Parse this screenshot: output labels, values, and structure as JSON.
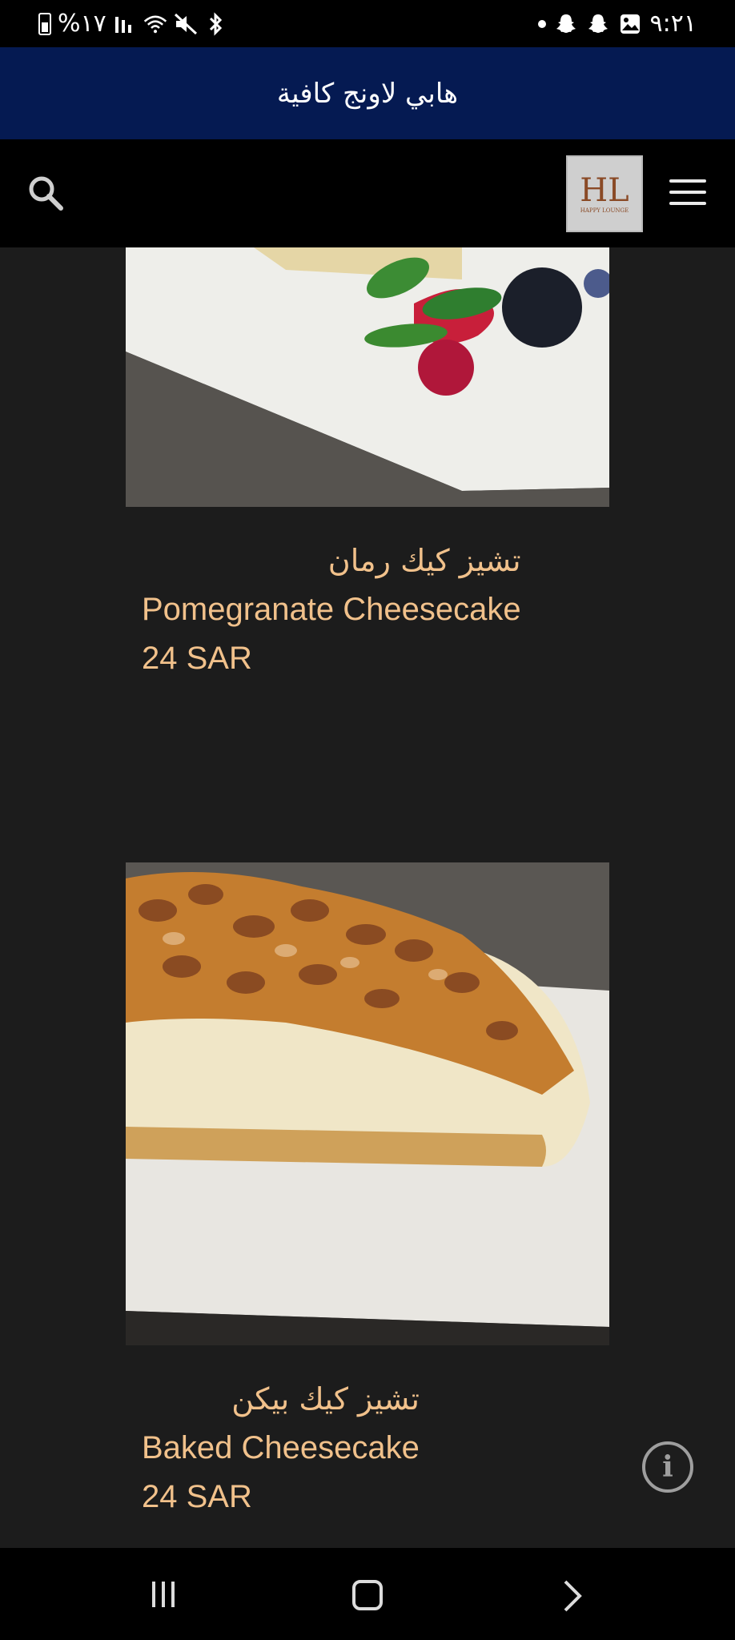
{
  "status_bar": {
    "battery_text": "%١٧",
    "time": "٩:٢١"
  },
  "header": {
    "title": "هابي لاونج كافية"
  },
  "nav": {
    "logo_text": "HL",
    "logo_subtext": "HAPPY LOUNGE"
  },
  "menu": {
    "items": [
      {
        "name_ar": "تشيز كيك رمان",
        "name_en": "Pomegranate Cheesecake",
        "price": "24 SAR"
      },
      {
        "name_ar": "تشيز كيك بيكن",
        "name_en": "Baked Cheesecake",
        "price": "24 SAR"
      }
    ]
  },
  "colors": {
    "title_bar": "#051a52",
    "accent_text": "#f1c18b",
    "background": "#1c1c1c"
  },
  "icons": [
    "battery-icon",
    "signal-icon",
    "wifi-icon",
    "mute-icon",
    "bluetooth-icon",
    "snapchat-icon",
    "gallery-icon",
    "search-icon",
    "menu-icon",
    "info-icon",
    "recent-apps-icon",
    "home-icon",
    "back-icon"
  ]
}
